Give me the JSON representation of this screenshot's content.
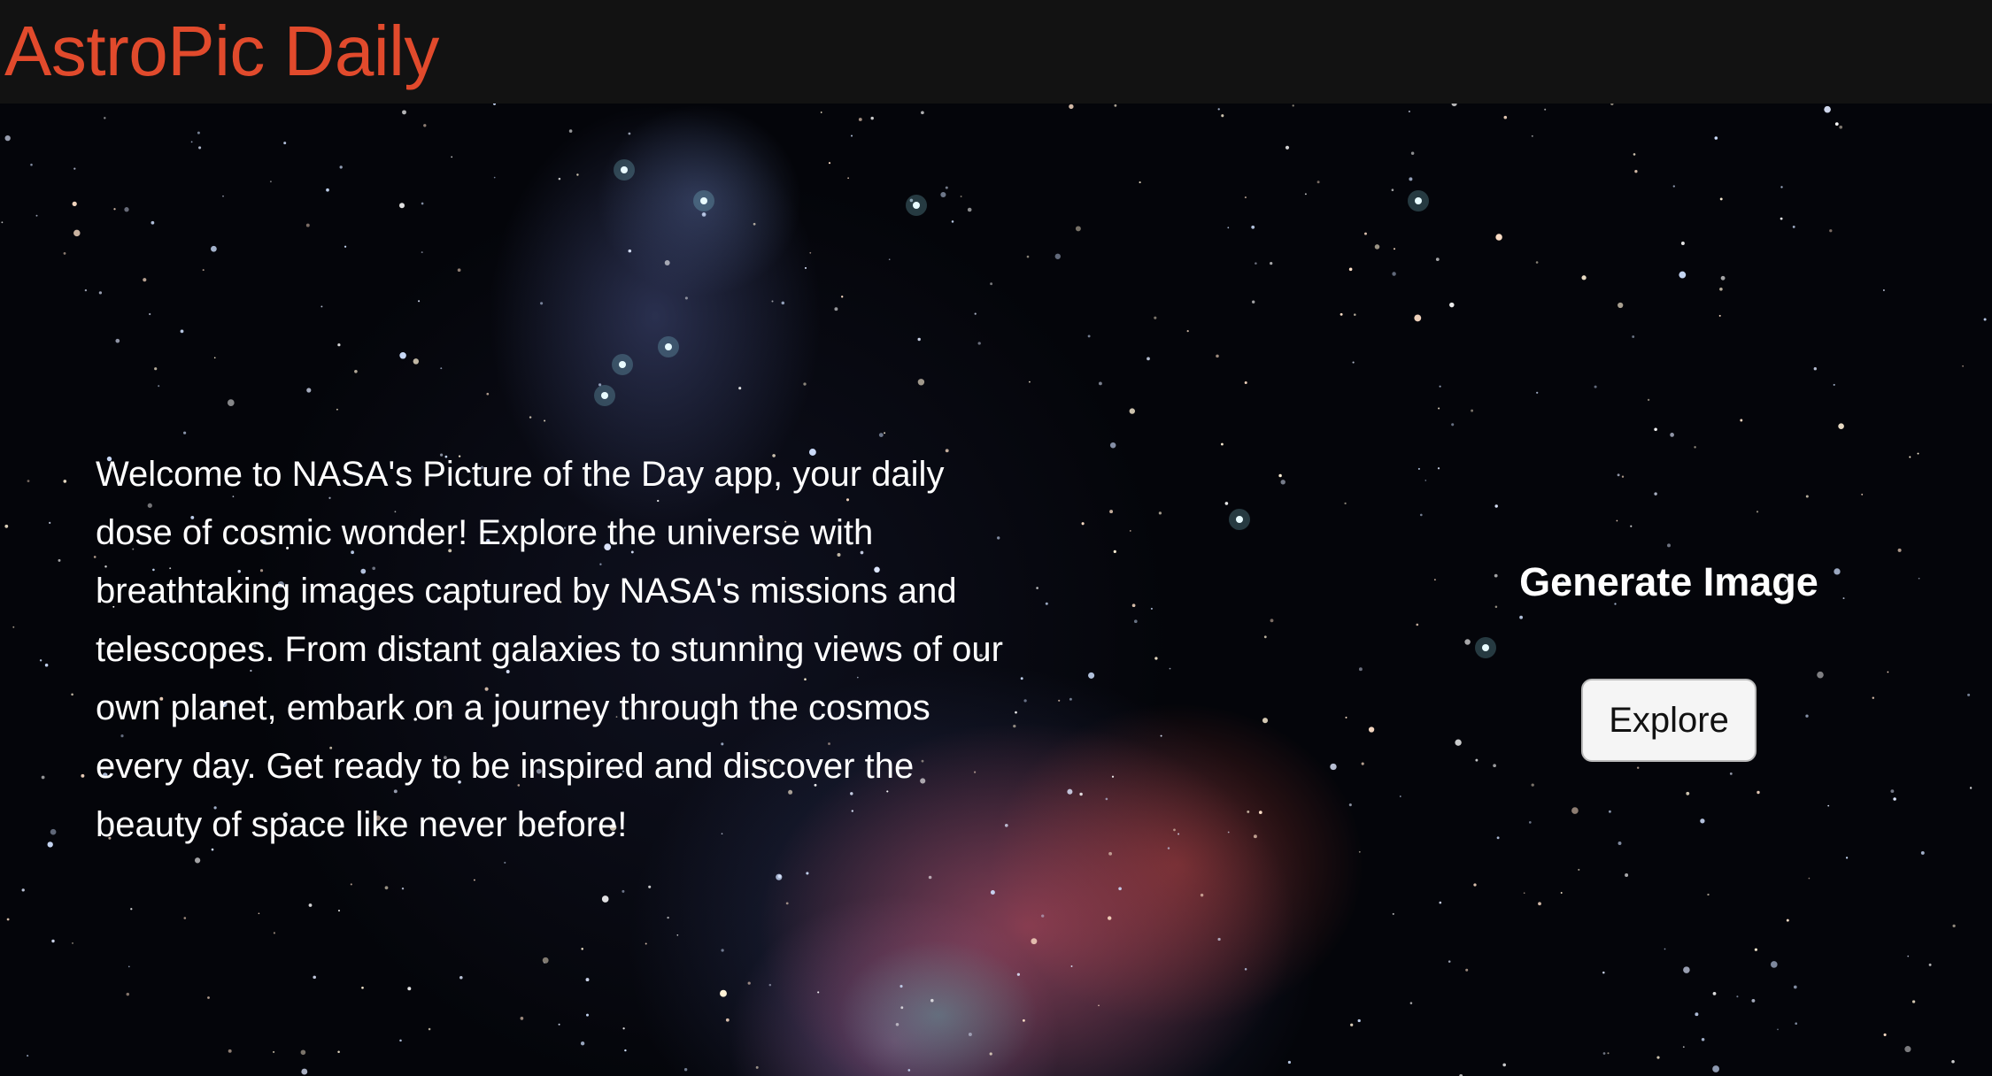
{
  "header": {
    "brand": "AstroPic Daily",
    "brand_color": "#e14a2c",
    "background": "#121212"
  },
  "hero": {
    "intro_text": "Welcome to NASA's Picture of the Day app, your daily dose of cosmic wonder! Explore the universe with breathtaking images captured by NASA's missions and telescopes. From distant galaxies to stunning views of our own planet, embark on a journey through the cosmos every day. Get ready to be inspired and discover the beauty of space like never before!",
    "generate_title": "Generate Image",
    "explore_label": "Explore",
    "background_image": "orion-nebula-starfield"
  }
}
